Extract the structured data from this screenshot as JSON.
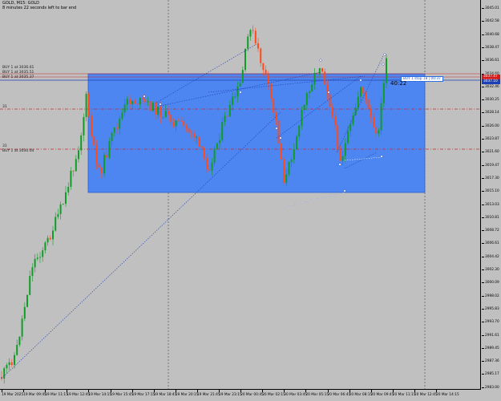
{
  "window": {
    "symbol_title": "GOLD, M15: GOLD",
    "countdown_text": "8 minutes 22 seconds left to bar end"
  },
  "trade_labels": [
    {
      "text": "BUY 1 at 3036.61"
    },
    {
      "text": "BUY 1 at 3035.51"
    },
    {
      "text": "BUY 1 at 3035.37"
    },
    {
      "text": "BUY 1 at 3030.04"
    }
  ],
  "level_markers": [
    "31",
    "31"
  ],
  "position_box_text": "BUY 1 stop 18 | 00:37",
  "bar_countdown": "40:22",
  "price_axis": [
    "3045.01",
    "3042.58",
    "3040.68",
    "3038.47",
    "3036.61",
    "3034.60",
    "3032.46",
    "3030.25",
    "3028.14",
    "3026.00",
    "3023.87",
    "3021.60",
    "3019.47",
    "3017.30",
    "3015.10",
    "3013.03",
    "3010.81",
    "3008.72",
    "3006.61",
    "3004.42",
    "3002.30",
    "3000.09",
    "2998.02",
    "2995.83",
    "2993.70",
    "2991.61",
    "2989.45",
    "2987.36",
    "2985.17",
    "2983.00"
  ],
  "price_badges": [
    {
      "text": "3037.47",
      "color": "#d21b1b"
    },
    {
      "text": "3037.10",
      "color": "#1d3fb8"
    }
  ],
  "time_axis": [
    "19 Mar 2025",
    "19 Mar 09:45",
    "19 Mar 11:15",
    "19 Mar 12:45",
    "19 Mar 14:15",
    "19 Mar 15:45",
    "19 Mar 17:15",
    "19 Mar 18:45",
    "19 Mar 20:15",
    "19 Mar 21:45",
    "19 Mar 23:15",
    "20 Mar 00:45",
    "20 Mar 02:15",
    "20 Mar 03:45",
    "20 Mar 05:15",
    "20 Mar 06:45",
    "20 Mar 08:15",
    "20 Mar 09:45",
    "20 Mar 11:15",
    "20 Mar 12:45",
    "20 Mar 14:15"
  ],
  "colors": {
    "background": "#c0c0c0",
    "bull_candle": "#0f9d26",
    "bear_candle": "#ff4a1c",
    "zone_fill": "#4d86f0",
    "sell_line": "#c62828",
    "buy_line": "#1f3fb0"
  }
}
